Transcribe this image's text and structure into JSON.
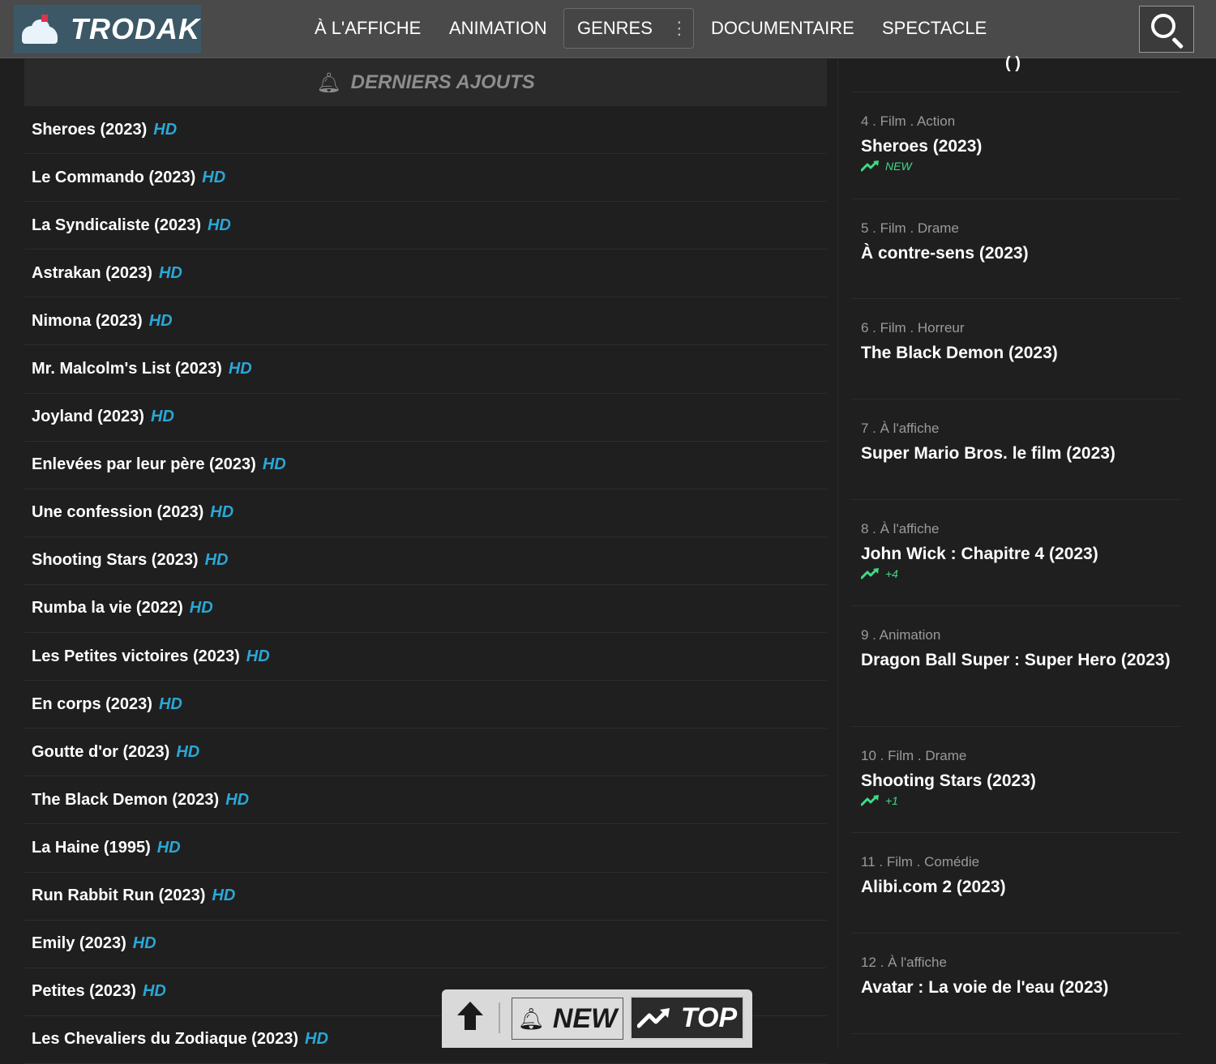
{
  "brand": {
    "name": "TRODAK"
  },
  "nav": {
    "affiche": "À L'AFFICHE",
    "animation": "ANIMATION",
    "genres": "GENRES",
    "documentaire": "DOCUMENTAIRE",
    "spectacle": "SPECTACLE"
  },
  "left_panel": {
    "title": "DERNIERS AJOUTS",
    "items": [
      {
        "title": "Sheroes (2023)",
        "badge": "HD"
      },
      {
        "title": "Le Commando (2023)",
        "badge": "HD"
      },
      {
        "title": "La Syndicaliste (2023)",
        "badge": "HD"
      },
      {
        "title": "Astrakan (2023)",
        "badge": "HD"
      },
      {
        "title": "Nimona (2023)",
        "badge": "HD"
      },
      {
        "title": "Mr. Malcolm's List (2023)",
        "badge": "HD"
      },
      {
        "title": "Joyland (2023)",
        "badge": "HD"
      },
      {
        "title": "Enlevées par leur père (2023)",
        "badge": "HD"
      },
      {
        "title": "Une confession (2023)",
        "badge": "HD"
      },
      {
        "title": "Shooting Stars (2023)",
        "badge": "HD"
      },
      {
        "title": "Rumba la vie (2022)",
        "badge": "HD"
      },
      {
        "title": "Les Petites victoires (2023)",
        "badge": "HD"
      },
      {
        "title": "En corps (2023)",
        "badge": "HD"
      },
      {
        "title": "Goutte d'or (2023)",
        "badge": "HD"
      },
      {
        "title": "The Black Demon (2023)",
        "badge": "HD"
      },
      {
        "title": "La Haine (1995)",
        "badge": "HD"
      },
      {
        "title": "Run Rabbit Run (2023)",
        "badge": "HD"
      },
      {
        "title": "Emily (2023)",
        "badge": "HD"
      },
      {
        "title": "Petites (2023)",
        "badge": "HD"
      },
      {
        "title": "Les Chevaliers du Zodiaque (2023)",
        "badge": "HD"
      }
    ]
  },
  "top_list": {
    "items": [
      {
        "meta": "4 . Film . Action",
        "title": "Sheroes (2023)",
        "trend": "NEW"
      },
      {
        "meta": "5 . Film . Drame",
        "title": "À contre-sens (2023)",
        "trend": ""
      },
      {
        "meta": "6 . Film . Horreur",
        "title": "The Black Demon (2023)",
        "trend": ""
      },
      {
        "meta": "7 . À l'affiche",
        "title": "Super Mario Bros. le film (2023)",
        "trend": ""
      },
      {
        "meta": "8 . À l'affiche",
        "title": "John Wick : Chapitre 4 (2023)",
        "trend": "+4"
      },
      {
        "meta": "9 . Animation",
        "title": "Dragon Ball Super : Super Hero (2023)",
        "trend": ""
      },
      {
        "meta": "10 . Film . Drame",
        "title": "Shooting Stars (2023)",
        "trend": "+1"
      },
      {
        "meta": "11 . Film . Comédie",
        "title": "Alibi.com 2 (2023)",
        "trend": ""
      },
      {
        "meta": "12 . À l'affiche",
        "title": "Avatar : La voie de l'eau (2023)",
        "trend": ""
      }
    ]
  },
  "fab": {
    "new_label": "NEW",
    "top_label": "TOP"
  },
  "colors": {
    "accent_hd": "#2aa7d6",
    "trend_green": "#3ddc84",
    "header_bg": "#4a4a4a",
    "page_bg": "#1f1f1f"
  },
  "icons": {
    "search": "search-icon",
    "bell": "bell-icon",
    "trend": "trending-up-icon",
    "up": "arrow-up-icon"
  }
}
